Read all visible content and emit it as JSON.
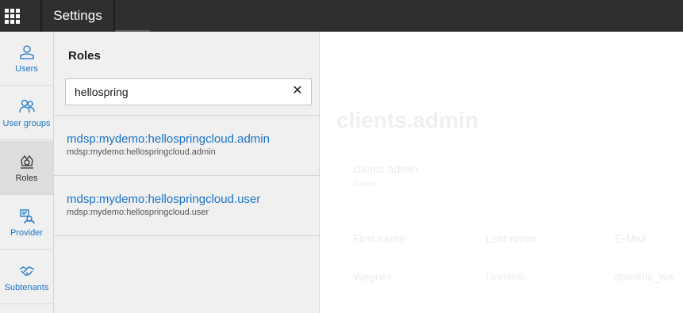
{
  "header": {
    "app_launcher_icon": "grid-icon",
    "title": "Settings"
  },
  "nav": {
    "items": [
      {
        "label": "Users",
        "icon": "user-icon",
        "active": false
      },
      {
        "label": "User groups",
        "icon": "user-group-icon",
        "active": false
      },
      {
        "label": "Roles",
        "icon": "roles-icon",
        "active": true
      },
      {
        "label": "Provider",
        "icon": "provider-icon",
        "active": false
      },
      {
        "label": "Subtenants",
        "icon": "handshake-icon",
        "active": false
      }
    ]
  },
  "roles_panel": {
    "title": "Roles",
    "search": {
      "value": "hellospring"
    },
    "results": [
      {
        "name": "mdsp:mydemo:hellospringcloud.admin",
        "subtitle": "mdsp:mydemo:hellospringcloud.admin"
      },
      {
        "name": "mdsp:mydemo:hellospringcloud.user",
        "subtitle": "mdsp:mydemo:hellospringcloud.user"
      }
    ]
  },
  "detail": {
    "title": "clients.admin",
    "name_value": "clients.admin",
    "name_label": "Name",
    "columns": [
      "First name",
      "Last name",
      "E-Mail"
    ],
    "row": [
      "Wagner",
      "Dominik",
      "dominic_wa"
    ]
  },
  "colors": {
    "topbar": "#2f2f2f",
    "link": "#1a73c8",
    "panel_bg": "#f0f0f0"
  }
}
